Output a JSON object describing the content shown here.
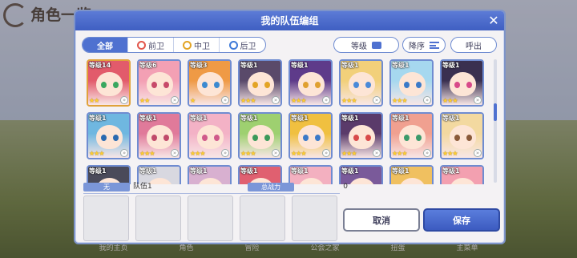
{
  "background": {
    "screen_title": "角色一览",
    "bottom_tabs": [
      "我的主页",
      "角色",
      "冒险",
      "公会之家",
      "扭蛋",
      "主菜单"
    ]
  },
  "dialog": {
    "title": "我的队伍编组",
    "close_glyph": "✕"
  },
  "filters": {
    "segments": [
      {
        "label": "全部",
        "icon": "",
        "active": true
      },
      {
        "label": "前卫",
        "icon": "front-role-icon",
        "active": false
      },
      {
        "label": "中卫",
        "icon": "mid-role-icon",
        "active": false
      },
      {
        "label": "后卫",
        "icon": "back-role-icon",
        "active": false
      }
    ],
    "sort_field": "等级",
    "sort_order": "降序",
    "call_out": "呼出"
  },
  "roster": {
    "cards": [
      {
        "level": "等级14",
        "stars": 2,
        "hair": "#e25b6b",
        "eyes": "#3aa860",
        "frame": "gold"
      },
      {
        "level": "等级6",
        "stars": 2,
        "hair": "#f3a0b4",
        "eyes": "#c74a6a",
        "frame": "blue"
      },
      {
        "level": "等级3",
        "stars": 1,
        "hair": "#ef9a45",
        "eyes": "#3c8ad0",
        "frame": "blue"
      },
      {
        "level": "等级1",
        "stars": 3,
        "hair": "#5a4a6a",
        "eyes": "#e3a425",
        "frame": "blue"
      },
      {
        "level": "等级1",
        "stars": 3,
        "hair": "#5e3b8a",
        "eyes": "#e0a030",
        "frame": "blue"
      },
      {
        "level": "等级1",
        "stars": 3,
        "hair": "#f2d07a",
        "eyes": "#4a8ad8",
        "frame": "blue"
      },
      {
        "level": "等级1",
        "stars": 3,
        "hair": "#a6d8ef",
        "eyes": "#3a7ac8",
        "frame": "blue"
      },
      {
        "level": "等级1",
        "stars": 3,
        "hair": "#3a3050",
        "eyes": "#d84a8a",
        "frame": "blue"
      },
      {
        "level": "等级1",
        "stars": 3,
        "hair": "#6fb7e0",
        "eyes": "#2a6ab0",
        "frame": "blue"
      },
      {
        "level": "等级1",
        "stars": 3,
        "hair": "#e07a9a",
        "eyes": "#c04a6a",
        "frame": "blue"
      },
      {
        "level": "等级1",
        "stars": 3,
        "hair": "#f3b2c6",
        "eyes": "#d05a8a",
        "frame": "blue"
      },
      {
        "level": "等级1",
        "stars": 3,
        "hair": "#9ed070",
        "eyes": "#3a9a5a",
        "frame": "blue"
      },
      {
        "level": "等级1",
        "stars": 3,
        "hair": "#f0c040",
        "eyes": "#3a7ac8",
        "frame": "blue"
      },
      {
        "level": "等级1",
        "stars": 3,
        "hair": "#5a3a6a",
        "eyes": "#d84a4a",
        "frame": "blue"
      },
      {
        "level": "等级1",
        "stars": 3,
        "hair": "#f0a090",
        "eyes": "#3a9a6a",
        "frame": "blue"
      },
      {
        "level": "等级1",
        "stars": 3,
        "hair": "#f3d9a0",
        "eyes": "#8a5a3a",
        "frame": "blue"
      },
      {
        "level": "等级1",
        "stars": 0,
        "hair": "#4a4a5a",
        "eyes": "#888888",
        "frame": "blue"
      },
      {
        "level": "等级1",
        "stars": 0,
        "hair": "#d8d8e0",
        "eyes": "#888888",
        "frame": "blue"
      },
      {
        "level": "等级1",
        "stars": 0,
        "hair": "#d8b0d0",
        "eyes": "#888888",
        "frame": "blue"
      },
      {
        "level": "等级1",
        "stars": 0,
        "hair": "#e06070",
        "eyes": "#888888",
        "frame": "blue"
      },
      {
        "level": "等级1",
        "stars": 0,
        "hair": "#f3b0c0",
        "eyes": "#888888",
        "frame": "blue"
      },
      {
        "level": "等级1",
        "stars": 0,
        "hair": "#7a5a9a",
        "eyes": "#888888",
        "frame": "blue"
      },
      {
        "level": "等级1",
        "stars": 0,
        "hair": "#f0c060",
        "eyes": "#888888",
        "frame": "blue"
      },
      {
        "level": "等级1",
        "stars": 0,
        "hair": "#f3a0b0",
        "eyes": "#888888",
        "frame": "blue"
      }
    ]
  },
  "team": {
    "tag": "无",
    "name": "队伍1",
    "power_label": "总战力",
    "power_value": "0",
    "slot_count": 5
  },
  "buttons": {
    "cancel": "取消",
    "save": "保存"
  },
  "colors": {
    "accent": "#4f71d0",
    "header": "#4a69c8",
    "star": "#ffcf2e"
  }
}
